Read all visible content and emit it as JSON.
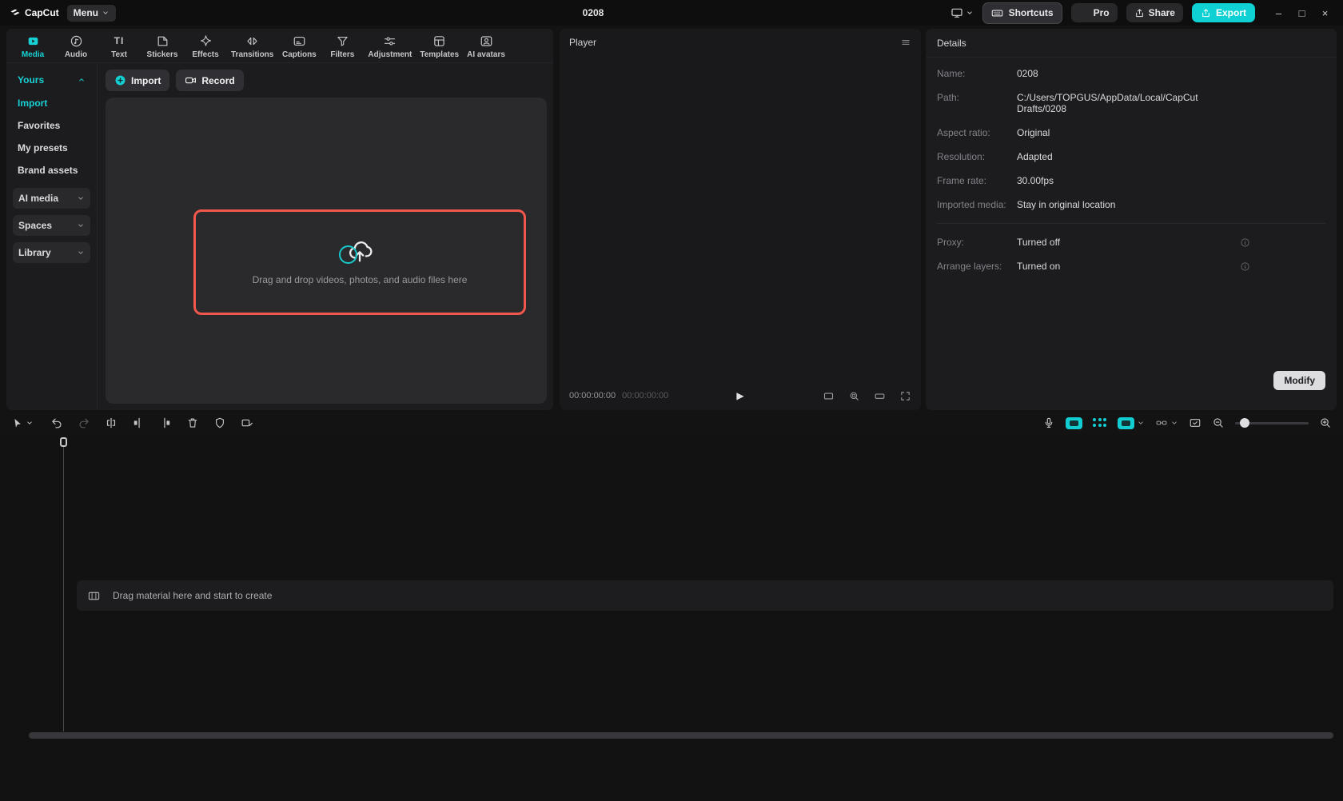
{
  "titlebar": {
    "app_name": "CapCut",
    "menu_label": "Menu",
    "project_title": "0208",
    "shortcuts_label": "Shortcuts",
    "pro_label": "Pro",
    "share_label": "Share",
    "export_label": "Export"
  },
  "media_panel": {
    "tabs": [
      {
        "label": "Media"
      },
      {
        "label": "Audio"
      },
      {
        "label": "Text"
      },
      {
        "label": "Stickers"
      },
      {
        "label": "Effects"
      },
      {
        "label": "Transitions"
      },
      {
        "label": "Captions"
      },
      {
        "label": "Filters"
      },
      {
        "label": "Adjustment"
      },
      {
        "label": "Templates"
      },
      {
        "label": "AI avatars"
      }
    ],
    "sidebar": {
      "section_label": "Yours",
      "items": [
        "Import",
        "Favorites",
        "My presets",
        "Brand assets"
      ],
      "dropdowns": [
        "AI media",
        "Spaces",
        "Library"
      ]
    },
    "import_label": "Import",
    "record_label": "Record",
    "dropzone_text": "Drag and drop videos, photos, and audio files here"
  },
  "player": {
    "title": "Player",
    "timecode_current": "00:00:00:00",
    "timecode_total": "00:00:00:00"
  },
  "details": {
    "title": "Details",
    "rows": [
      {
        "label": "Name:",
        "value": "0208"
      },
      {
        "label": "Path:",
        "value": "C:/Users/TOPGUS/AppData/Local/CapCut Drafts/0208"
      },
      {
        "label": "Aspect ratio:",
        "value": "Original"
      },
      {
        "label": "Resolution:",
        "value": "Adapted"
      },
      {
        "label": "Frame rate:",
        "value": "30.00fps"
      },
      {
        "label": "Imported media:",
        "value": "Stay in original location"
      }
    ],
    "toggles": [
      {
        "label": "Proxy:",
        "value": "Turned off"
      },
      {
        "label": "Arrange layers:",
        "value": "Turned on"
      }
    ],
    "modify_label": "Modify"
  },
  "timeline": {
    "empty_text": "Drag material here and start to create"
  },
  "colors": {
    "accent": "#12ced2",
    "drop_border": "#f2574d"
  }
}
